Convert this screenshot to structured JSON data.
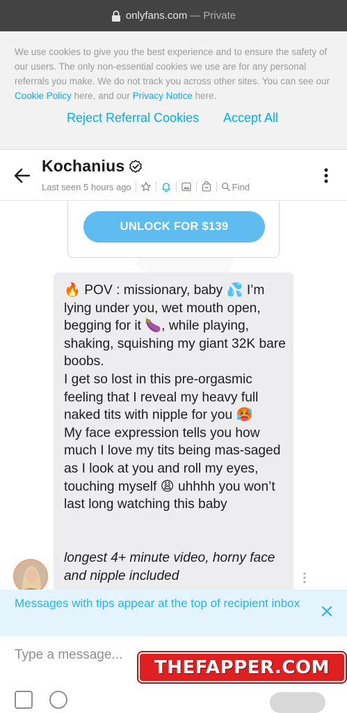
{
  "browser": {
    "domain": "onlyfans.com",
    "mode": "— Private"
  },
  "cookie_banner": {
    "text_1": "We use cookies to give you the best experience and to ensure the safety of our users. The only non-essential cookies we use are for any personal referrals you make. We do not track you across other sites. You can see our ",
    "cookie_policy_link": "Cookie Policy",
    "text_2": " here, and our ",
    "privacy_link": "Privacy Notice",
    "text_3": " here.",
    "reject_label": "Reject Referral Cookies",
    "accept_label": "Accept All",
    "link_color": "#00aff0"
  },
  "chat_header": {
    "name": "Kochanius",
    "last_seen": "Last seen 5 hours ago",
    "find_label": "Find",
    "icons": [
      "back-arrow-icon",
      "verified-icon",
      "star-icon",
      "bell-icon",
      "image-icon",
      "vault-icon",
      "search-icon",
      "kebab-icon"
    ]
  },
  "locked_message": {
    "unlock_label": "UNLOCK FOR $139",
    "button_color": "#5ebcf0"
  },
  "message": {
    "body": "🔥 POV : missionary, baby 💦 I’m lying under you, wet mouth open, begging for it 🍆, while playing, shaking, squishing my giant 32K bare boobs.\nI get so lost in this pre-orgasmic feeling that I reveal my heavy full naked tits with nipple for you 🥵\nMy face expression tells you how much I love my tits being mas-saged as I look at you and roll my eyes, touching myself 😩 uhhhh you won’t last long watching this baby",
    "italic_line": "longest 4+ minute video, horny face and nipple included"
  },
  "tip_notice": {
    "text": "Messages with tips appear at the top of recipient inbox"
  },
  "composer": {
    "placeholder": "Type a message..."
  },
  "overlay_logo": {
    "text": "THEFAPPER.COM"
  }
}
